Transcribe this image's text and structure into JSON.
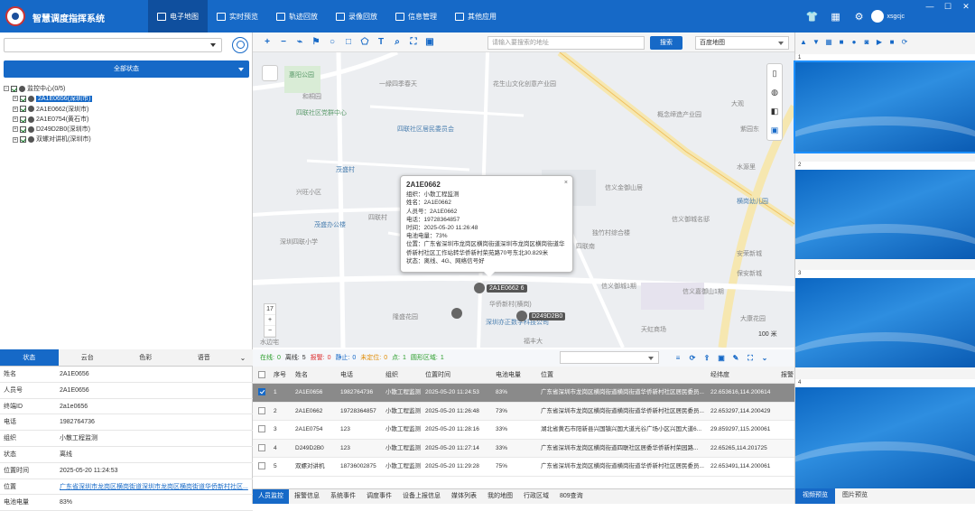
{
  "header": {
    "title": "智慧调度指挥系统",
    "user": "xsgcjc",
    "nav": [
      {
        "label": "电子地图",
        "icon": "map-icon"
      },
      {
        "label": "实时预览",
        "icon": "play-icon"
      },
      {
        "label": "轨迹回放",
        "icon": "route-icon"
      },
      {
        "label": "录像回放",
        "icon": "video-icon"
      },
      {
        "label": "信息管理",
        "icon": "info-icon"
      },
      {
        "label": "其他应用",
        "icon": "apps-icon"
      }
    ]
  },
  "left": {
    "search_placeholder": "",
    "status_button": "全部状态",
    "tree": [
      {
        "label": "监控中心(0/5)",
        "level": 0
      },
      {
        "label": "2A1E0656(深圳市)",
        "level": 1,
        "selected": true
      },
      {
        "label": "2A1E0662(深圳市)",
        "level": 1
      },
      {
        "label": "2A1E0754(黄石市)",
        "level": 1
      },
      {
        "label": "D249D2B0(深圳市)",
        "level": 1
      },
      {
        "label": "双螺对讲机(深圳市)",
        "level": 1
      }
    ],
    "tabs": [
      "状态",
      "云台",
      "色彩",
      "语音"
    ],
    "props": [
      {
        "k": "姓名",
        "v": "2A1E0656"
      },
      {
        "k": "人员号",
        "v": "2A1E0656"
      },
      {
        "k": "终端ID",
        "v": "2a1e0656"
      },
      {
        "k": "电话",
        "v": "1982764736"
      },
      {
        "k": "组织",
        "v": "小散工程监测"
      },
      {
        "k": "状态",
        "v": "离线"
      },
      {
        "k": "位置时间",
        "v": "2025-05-20 11:24:53"
      },
      {
        "k": "位置",
        "v": "广东省深圳市龙岗区横岗街道深圳市龙岗区横岗街道华侨新村社区..."
      },
      {
        "k": "电池电量",
        "v": "83%"
      }
    ]
  },
  "map": {
    "address_placeholder": "请输入要搜索的地址",
    "search_button": "搜索",
    "map_type": "百度地图",
    "zoom_level": "17",
    "scale": "100 米",
    "labels": [
      "惠阳公园",
      "一緑四季春天",
      "花生山文化创意产业园",
      "和桐园",
      "四联社区党群中心",
      "四联社区居民委员会",
      "概念缔造产业园",
      "大观",
      "紫园东",
      "茂盛村",
      "兴旺小区",
      "信义金御山居",
      "水源里",
      "四联村",
      "横岗幼儿园",
      "茂盛办公楼",
      "深圳四联小学",
      "信义御城名邸",
      "独竹村综合楼",
      "隆盛花园",
      "华侨新村(横岗)",
      "深圳亦正数学科技公司",
      "信义御城1期",
      "安荣新城",
      "天虹商场",
      "福丰大",
      "大康花园",
      "信义嘉御山1期",
      "保安新城",
      "四联南",
      "水边宅"
    ],
    "popup": {
      "title": "2A1E0662",
      "lines": [
        "组织：小散工程监测",
        "姓名：2A1E0662",
        "人员号：2A1E0662",
        "电话：19728364857",
        "时间：2025-05-20 11:26:48",
        "电池电量：73%",
        "位置：广东省深圳市龙岗区横岗街道深圳市龙岗区横岗街道华侨新村社区工作站转华侨新村荣苑路70号东北30.829米",
        "状态：离线、4G、网络信号好"
      ]
    },
    "markers": [
      "2A1E0662 6",
      "D249D2B0"
    ]
  },
  "statusbar": {
    "items": [
      {
        "label": "在线:",
        "value": "0",
        "color": "#2a9d2a"
      },
      {
        "label": "离线:",
        "value": "5",
        "color": "#333"
      },
      {
        "label": "报警:",
        "value": "0",
        "color": "#d33"
      },
      {
        "label": "静止:",
        "value": "0",
        "color": "#1669c7"
      },
      {
        "label": "未定位:",
        "value": "0",
        "color": "#e08a00"
      },
      {
        "label": "点:",
        "value": "1",
        "color": "#2a9d2a"
      },
      {
        "label": "圆形区域:",
        "value": "1",
        "color": "#2a9d2a"
      }
    ]
  },
  "table": {
    "headers": [
      "",
      "序号",
      "姓名",
      "电话",
      "组织",
      "位置时间",
      "电池电量",
      "位置",
      "经纬度",
      "报警"
    ],
    "rows": [
      [
        "1",
        "2A1E0656",
        "1982764736",
        "小散工程监测",
        "2025-05-20 11:24:53",
        "83%",
        "广东省深圳市龙岗区横岗街道横岗街道华侨新村社区居民委员...",
        "22.653616,114.200614",
        ""
      ],
      [
        "2",
        "2A1E0662",
        "19728364857",
        "小散工程监测",
        "2025-05-20 11:26:48",
        "73%",
        "广东省深圳市龙岗区横岗街道横岗街道华侨新村社区居民委员...",
        "22.653297,114.200429",
        ""
      ],
      [
        "3",
        "2A1E0754",
        "123",
        "小散工程监测",
        "2025-05-20 11:28:16",
        "33%",
        "湖北省黄石市阳新县兴国镇兴国大道光谷广场小区兴国大道6...",
        "29.859297,115.200061",
        ""
      ],
      [
        "4",
        "D249D2B0",
        "123",
        "小散工程监测",
        "2025-05-20 11:27:14",
        "33%",
        "广东省深圳市龙岗区横岗街道四联社区居委华侨新村荣园路...",
        "22.65265,114.201725",
        ""
      ],
      [
        "5",
        "双螺对讲机",
        "18736002875",
        "小散工程监测",
        "2025-05-20 11:29:28",
        "75%",
        "广东省深圳市龙岗区横岗街道横岗街道华侨新村社区居民委员...",
        "22.653491,114.200061",
        ""
      ]
    ]
  },
  "bottom_tabs": [
    "人员监控",
    "报警信息",
    "系统事件",
    "调度事件",
    "设备上报信息",
    "媒体列表",
    "我的地图",
    "行政区域",
    "809查询"
  ],
  "right": {
    "panes": [
      "1",
      "2",
      "3",
      "4"
    ],
    "tabs": [
      "视频预览",
      "图片预览"
    ]
  },
  "colors": {
    "primary": "#1669c7"
  }
}
